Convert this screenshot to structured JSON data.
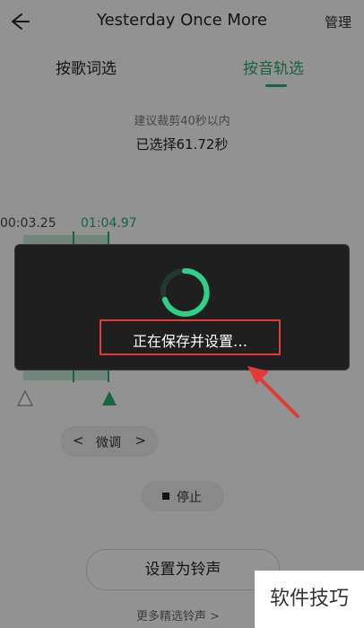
{
  "header": {
    "title": "Yesterday Once More",
    "manage_label": "管理"
  },
  "tabs": [
    {
      "label": "按歌词选",
      "active": false
    },
    {
      "label": "按音轨选",
      "active": true
    }
  ],
  "trim": {
    "hint": "建议裁剪40秒以内",
    "selected": "已选择61.72秒",
    "start_time": "00:03.25",
    "end_time": "01:04.97"
  },
  "fine_tune": {
    "prev": "<",
    "label": "微调",
    "next": ">"
  },
  "stop_label": "停止",
  "set_ringtone_label": "设置为铃声",
  "more_link": "更多精选铃声 >",
  "loading": {
    "message": "正在保存并设置…"
  },
  "watermark": "软件技巧",
  "colors": {
    "accent": "#27a56e",
    "highlight": "#e23a3a"
  }
}
